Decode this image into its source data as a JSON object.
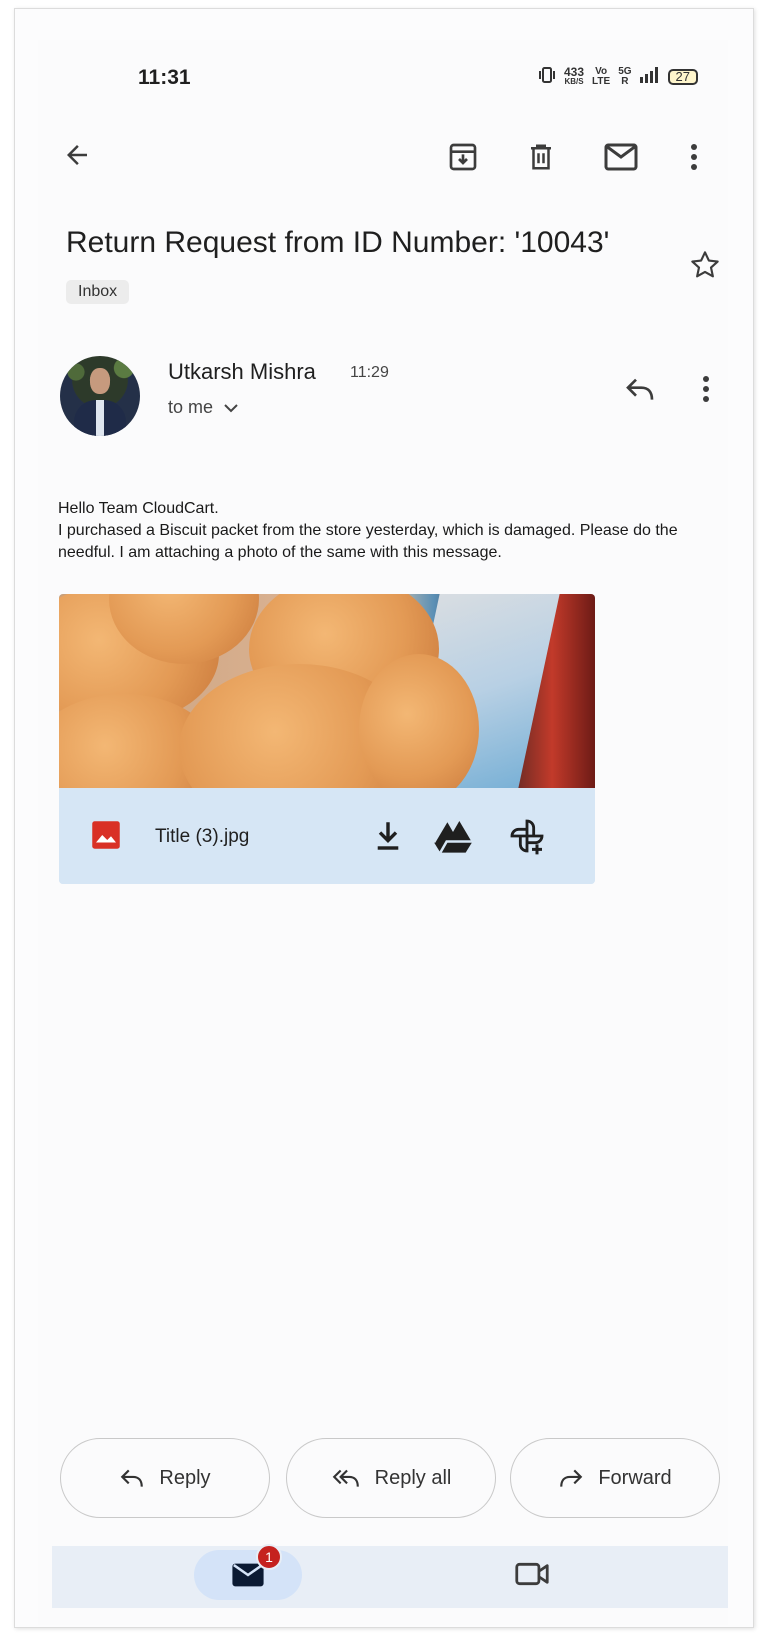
{
  "status_bar": {
    "time": "11:31",
    "speed_value": "433",
    "speed_unit": "KB/S",
    "volte_top": "Vo",
    "volte_bottom": "LTE",
    "network_top": "5G",
    "network_bottom": "R",
    "battery": "27"
  },
  "toolbar": {
    "back_icon": "arrow-left-icon",
    "archive_icon": "archive-icon",
    "delete_icon": "trash-icon",
    "mark_unread_icon": "mail-icon",
    "more_icon": "more-vert-icon"
  },
  "email": {
    "subject": "Return Request from ID Number: '10043'",
    "label": "Inbox",
    "sender_name": "Utkarsh Mishra",
    "time": "11:29",
    "recipient": "to me",
    "body_lines": [
      "Hello Team CloudCart.",
      "I purchased a Biscuit packet from the store yesterday, which is damaged. Please do the needful. I am attaching a photo of the same with this message."
    ]
  },
  "attachment": {
    "filename": "Title (3).jpg",
    "type_icon": "image-file-icon",
    "actions": [
      "download-icon",
      "drive-icon",
      "add-to-photos-icon"
    ]
  },
  "actions": {
    "reply": "Reply",
    "reply_all": "Reply all",
    "forward": "Forward"
  },
  "bottom_nav": {
    "mail_badge": "1",
    "mail_icon": "mail-icon",
    "meet_icon": "video-camera-icon"
  },
  "colors": {
    "accent": "#d4e3f8",
    "badge": "#c5221f",
    "attachment_bar": "#d6e6f5",
    "image_icon": "#d93025"
  }
}
